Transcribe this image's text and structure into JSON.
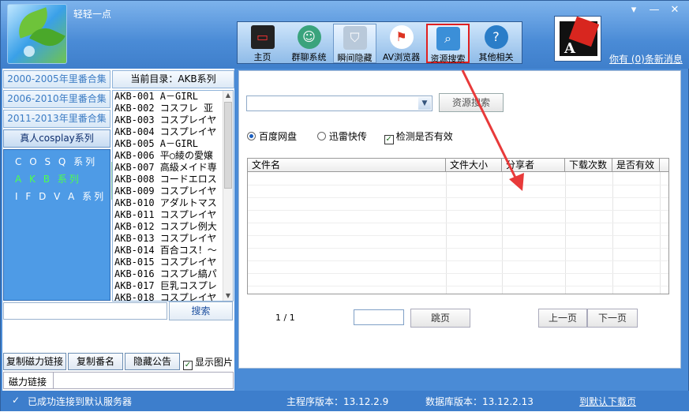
{
  "window": {
    "title": "轻轻一点"
  },
  "toolbar": {
    "items": [
      {
        "label": "主页",
        "icon": "monitor-icon"
      },
      {
        "label": "群聊系统",
        "icon": "chat-icon"
      },
      {
        "label": "瞬间隐藏",
        "icon": "shield-icon"
      },
      {
        "label": "AV浏览器",
        "icon": "browser-icon"
      },
      {
        "label": "资源搜索",
        "icon": "search-icon"
      },
      {
        "label": "其他相关",
        "icon": "info-icon"
      }
    ]
  },
  "header": {
    "messages_link": "你有 (0)条新消息"
  },
  "sidebar": {
    "categories": [
      "2000-2005年里番合集",
      "2006-2010年里番合集",
      "2011-2013年里番合集",
      "真人cosplay系列"
    ],
    "subcategories": [
      "C O S Q 系列",
      "A K B 系列",
      "I F D V A 系列"
    ],
    "current_dir": "当前目录：AKB系列",
    "list": [
      "AKB-001 A－GIRL",
      "AKB-002 コスフレ 亚",
      "AKB-003 コスプレイヤ",
      "AKB-004 コスプレイヤ",
      "AKB-005 A－GIRL",
      "AKB-006 平○綾の愛嬢",
      "AKB-007 高級メイド専",
      "AKB-008 コードエロス",
      "AKB-009 コスプレイヤ",
      "AKB-010 アダルトマス",
      "AKB-011 コスプレイヤ",
      "AKB-012 コスプレ例大",
      "AKB-013 コスプレイヤ",
      "AKB-014 百合コス！～",
      "AKB-015 コスプレイヤ",
      "AKB-016 コスプレ縞パ",
      "AKB-017 巨乳コスプレ",
      "AKB-018 コスプレイヤ"
    ],
    "search_button": "搜索",
    "buttons": {
      "copy_magnet": "复制磁力链接",
      "copy_code": "复制番名",
      "hide_notice": "隐藏公告",
      "show_images": "显示图片"
    },
    "magnet_label": "磁力链接"
  },
  "search_panel": {
    "search_button": "资源搜索",
    "options": {
      "baidu": "百度网盘",
      "xunlei": "迅雷快传",
      "check_valid": "检测是否有效"
    },
    "columns": [
      "文件名",
      "文件大小",
      "分享者",
      "下载次数",
      "是否有效"
    ],
    "pager": {
      "page_text": "1 / 1",
      "jump": "跳页",
      "prev": "上一页",
      "next": "下一页"
    }
  },
  "status": {
    "connection": "已成功连接到默认服务器",
    "main_version": "主程序版本：13.12.2.9",
    "db_version": "数据库版本：13.12.2.13",
    "default_download": "到默认下载页"
  },
  "colors": {
    "titlebar": "#4a8bd6",
    "accent": "#e02020",
    "active_subcat": "#4dff4d"
  }
}
